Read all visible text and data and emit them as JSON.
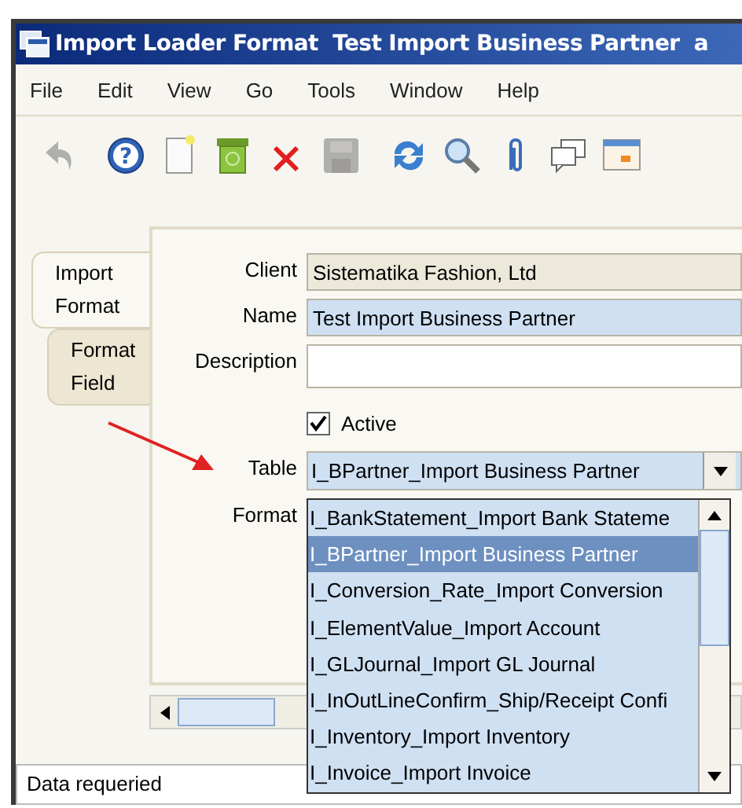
{
  "window": {
    "title": "Import Loader Format  Test Import Business Partner  a"
  },
  "menu": [
    "File",
    "Edit",
    "View",
    "Go",
    "Tools",
    "Window",
    "Help"
  ],
  "toolbar": [
    {
      "kind": "undo",
      "disabled": true
    },
    {
      "kind": "help",
      "disabled": false,
      "glyph": "?"
    },
    {
      "kind": "new",
      "disabled": false
    },
    {
      "kind": "trash",
      "disabled": false
    },
    {
      "kind": "delete",
      "disabled": false
    },
    {
      "kind": "save",
      "disabled": true
    },
    {
      "kind": "refresh",
      "disabled": false
    },
    {
      "kind": "find",
      "disabled": false
    },
    {
      "kind": "attach",
      "disabled": false
    },
    {
      "kind": "chat",
      "disabled": false
    },
    {
      "kind": "grid",
      "disabled": false
    }
  ],
  "tabs": [
    {
      "label": "Import\nFormat",
      "selected": true
    },
    {
      "label": "Format\nField",
      "selected": false
    }
  ],
  "form": {
    "client": {
      "label": "Client",
      "value": "Sistematika Fashion, Ltd"
    },
    "name": {
      "label": "Name",
      "value": "Test Import Business Partner"
    },
    "description": {
      "label": "Description"
    },
    "active": {
      "label": "Active",
      "checked": true
    },
    "table": {
      "label": "Table",
      "value": "I_BPartner_Import Business Partner"
    },
    "format": {
      "label": "Format"
    }
  },
  "dropdown": [
    {
      "label": "I_BankStatement_Import Bank Stateme",
      "selected": false
    },
    {
      "label": "I_BPartner_Import Business Partner",
      "selected": true
    },
    {
      "label": "I_Conversion_Rate_Import Conversion",
      "selected": false
    },
    {
      "label": "I_ElementValue_Import Account",
      "selected": false
    },
    {
      "label": "I_GLJournal_Import GL Journal",
      "selected": false
    },
    {
      "label": "I_InOutLineConfirm_Ship/Receipt Confi",
      "selected": false
    },
    {
      "label": "I_Inventory_Import Inventory",
      "selected": false
    },
    {
      "label": "I_Invoice_Import Invoice",
      "selected": false
    }
  ],
  "status_bar": "Data requeried"
}
